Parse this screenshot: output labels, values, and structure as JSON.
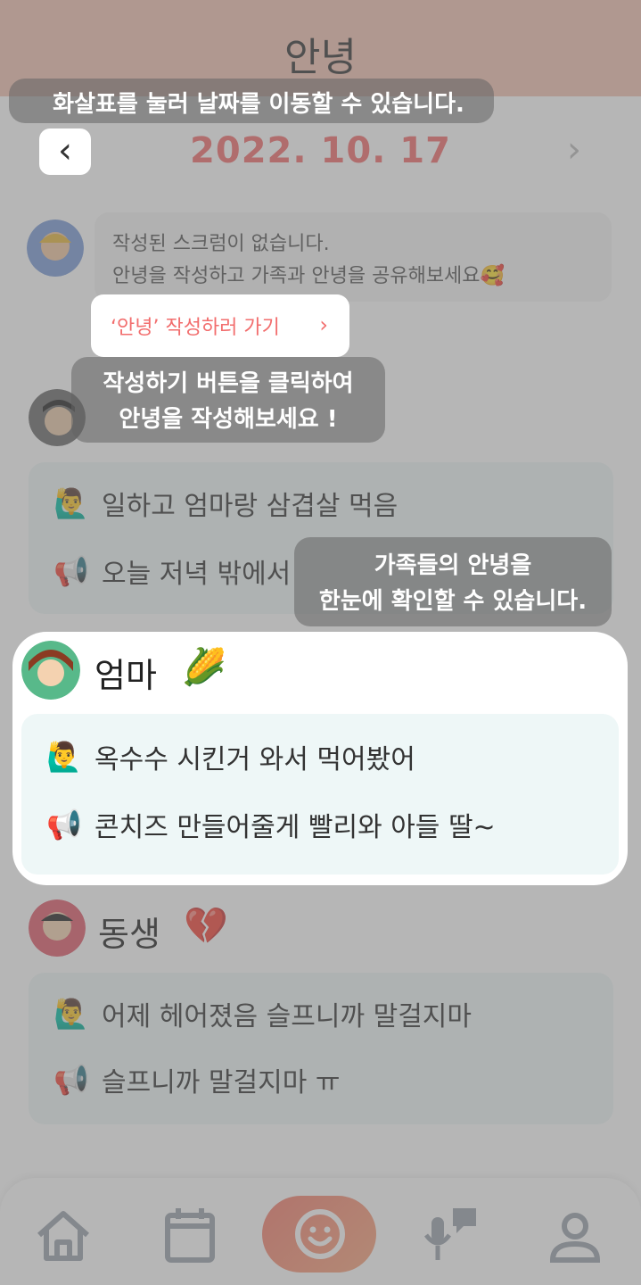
{
  "header": {
    "title": "안녕"
  },
  "date": {
    "text": "2022. 10. 17",
    "prev_icon": "chevron-left-icon",
    "next_icon": "chevron-right-icon"
  },
  "empty_post": {
    "line1": "작성된 스크럼이 없습니다.",
    "line2": "안녕을 작성하고 가족과 안녕을 공유해보세요🥰"
  },
  "write_button": {
    "label": "‘안녕’ 작성하러 가기"
  },
  "members": [
    {
      "name": "",
      "lines": [
        {
          "icon": "🙋‍♂️",
          "text": "일하고 엄마랑 삼겹살 먹음"
        },
        {
          "icon": "📢",
          "text": "오늘 저녁 밖에서"
        }
      ]
    },
    {
      "name": "엄마",
      "mood": "🌽",
      "lines": [
        {
          "icon": "🙋‍♂️",
          "text": "옥수수 시킨거 와서 먹어봤어"
        },
        {
          "icon": "📢",
          "text": "콘치즈 만들어줄게 빨리와 아들 딸~"
        }
      ]
    },
    {
      "name": "동생",
      "mood": "💔",
      "lines": [
        {
          "icon": "🙋‍♂️",
          "text": "어제 헤어졌음 슬프니까 말걸지마"
        },
        {
          "icon": "📢",
          "text": "슬프니까 말걸지마 ㅠ"
        }
      ]
    }
  ],
  "tutorial": {
    "date_tip": "화살표를 눌러 날짜를 이동할 수 있습니다.",
    "write_tip_1": "작성하기 버튼을 클릭하여",
    "write_tip_2": "안녕을 작성해보세요 !",
    "family_tip_1": "가족들의 안녕을",
    "family_tip_2": "한눈에 확인할 수 있습니다."
  },
  "nav": [
    "home-icon",
    "calendar-icon",
    "smile-icon",
    "mic-chat-icon",
    "profile-icon"
  ],
  "colors": {
    "accent": "#f26d6d",
    "header": "#f3c3b3",
    "card": "#eef7f7"
  }
}
